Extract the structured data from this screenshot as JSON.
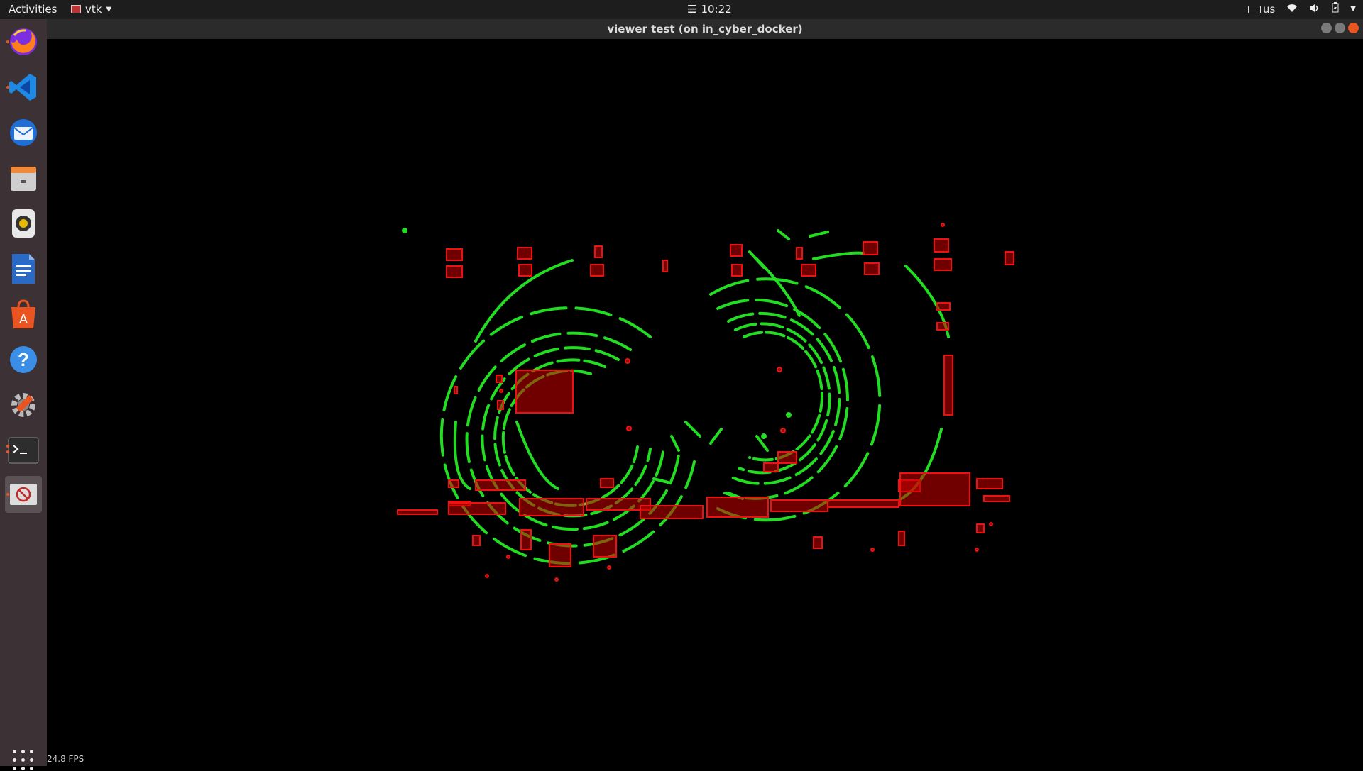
{
  "topbar": {
    "activities_label": "Activities",
    "app_name": "vtk",
    "clock": "10:22",
    "keyboard_layout": "us"
  },
  "window": {
    "title": "viewer test (on in_cyber_docker)"
  },
  "viewer": {
    "fps_label": "24.8 FPS",
    "colors": {
      "lidar_points": "#22dd22",
      "obstacle_boxes": "#ee1111",
      "background": "#000000"
    }
  },
  "dock": {
    "items": [
      "firefox-icon",
      "vscode-icon",
      "thunderbird-icon",
      "files-icon",
      "rhythmbox-icon",
      "writer-icon",
      "software-icon",
      "help-icon",
      "settings-icon",
      "terminal-icon",
      "vtk-app-icon"
    ],
    "accent": "#e95420"
  }
}
